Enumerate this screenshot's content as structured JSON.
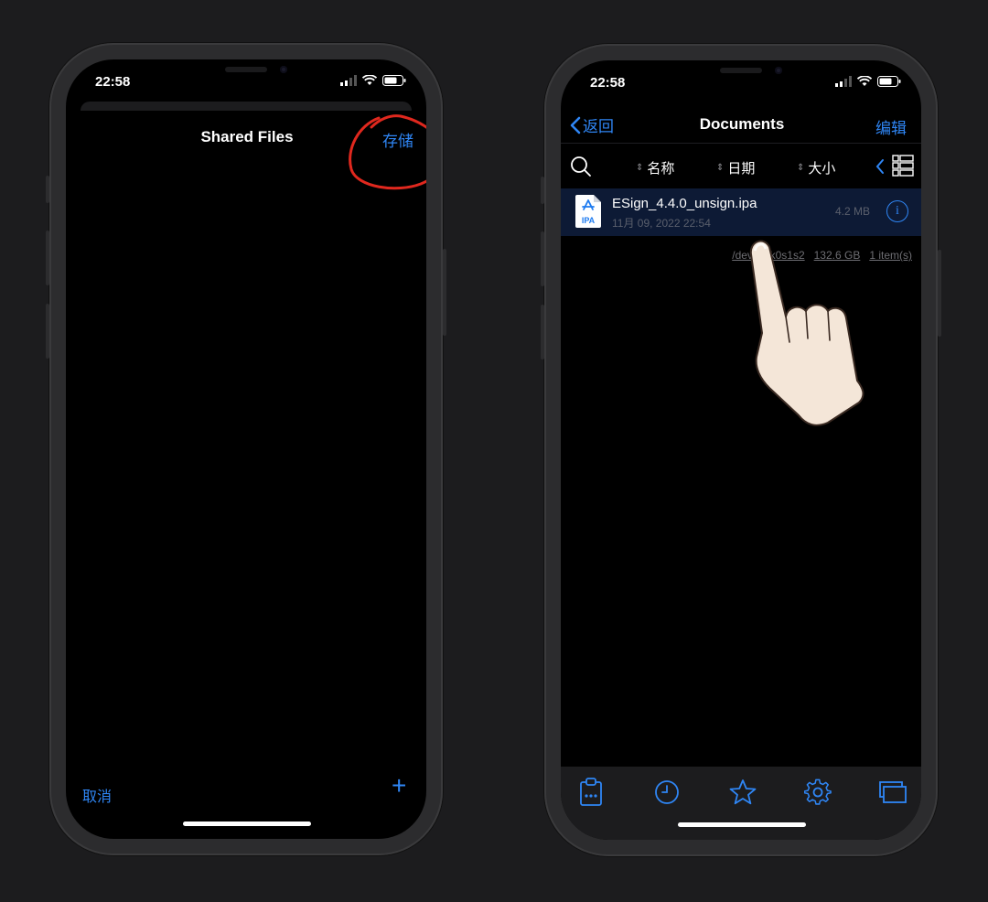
{
  "left_phone": {
    "status": {
      "time": "22:58"
    },
    "header": {
      "title": "Shared Files",
      "save_label": "存储"
    },
    "footer": {
      "cancel_label": "取消",
      "add_label": "+"
    }
  },
  "right_phone": {
    "status": {
      "time": "22:58"
    },
    "nav": {
      "back_label": "返回",
      "title": "Documents",
      "edit_label": "编辑"
    },
    "sort_bar": {
      "name_label": "名称",
      "date_label": "日期",
      "size_label": "大小"
    },
    "files": [
      {
        "name": "ESign_4.4.0_unsign.ipa",
        "date": "11月 09, 2022 22:54",
        "size": "4.2 MB",
        "badge": "IPA"
      }
    ],
    "storage_info": {
      "device": "/dev/disk0s1s2",
      "capacity": "132.6 GB",
      "items": "1 item(s)"
    },
    "tab_bar": [
      "clipboard-icon",
      "clock-icon",
      "star-icon",
      "gear-icon",
      "windows-icon"
    ]
  },
  "colors": {
    "accent": "#2f86f5",
    "annotation": "#e0281e",
    "background": "#1c1c1e"
  }
}
